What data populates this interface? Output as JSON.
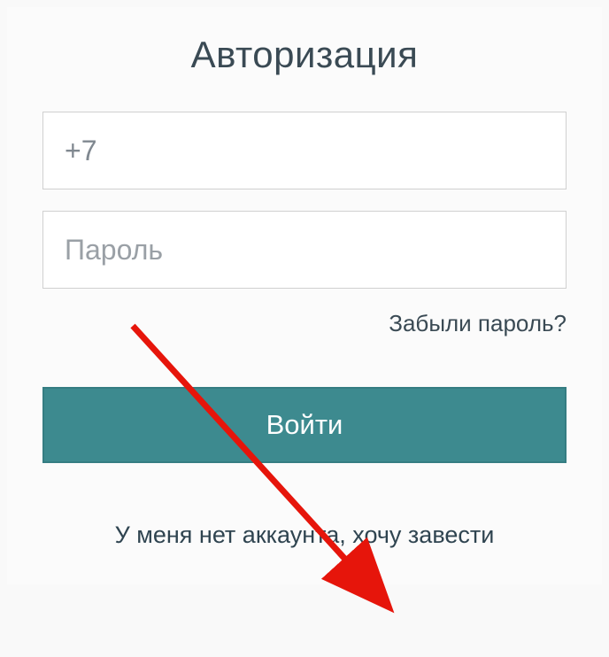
{
  "login": {
    "title": "Авторизация",
    "phone_value": "+7",
    "password_placeholder": "Пароль",
    "forgot_password_label": "Забыли пароль?",
    "submit_label": "Войти",
    "signup_label": "У меня нет аккаунта, хочу завести"
  },
  "colors": {
    "accent": "#3d8a8f",
    "text_dark": "#3a4a54",
    "arrow": "#e6150b"
  }
}
